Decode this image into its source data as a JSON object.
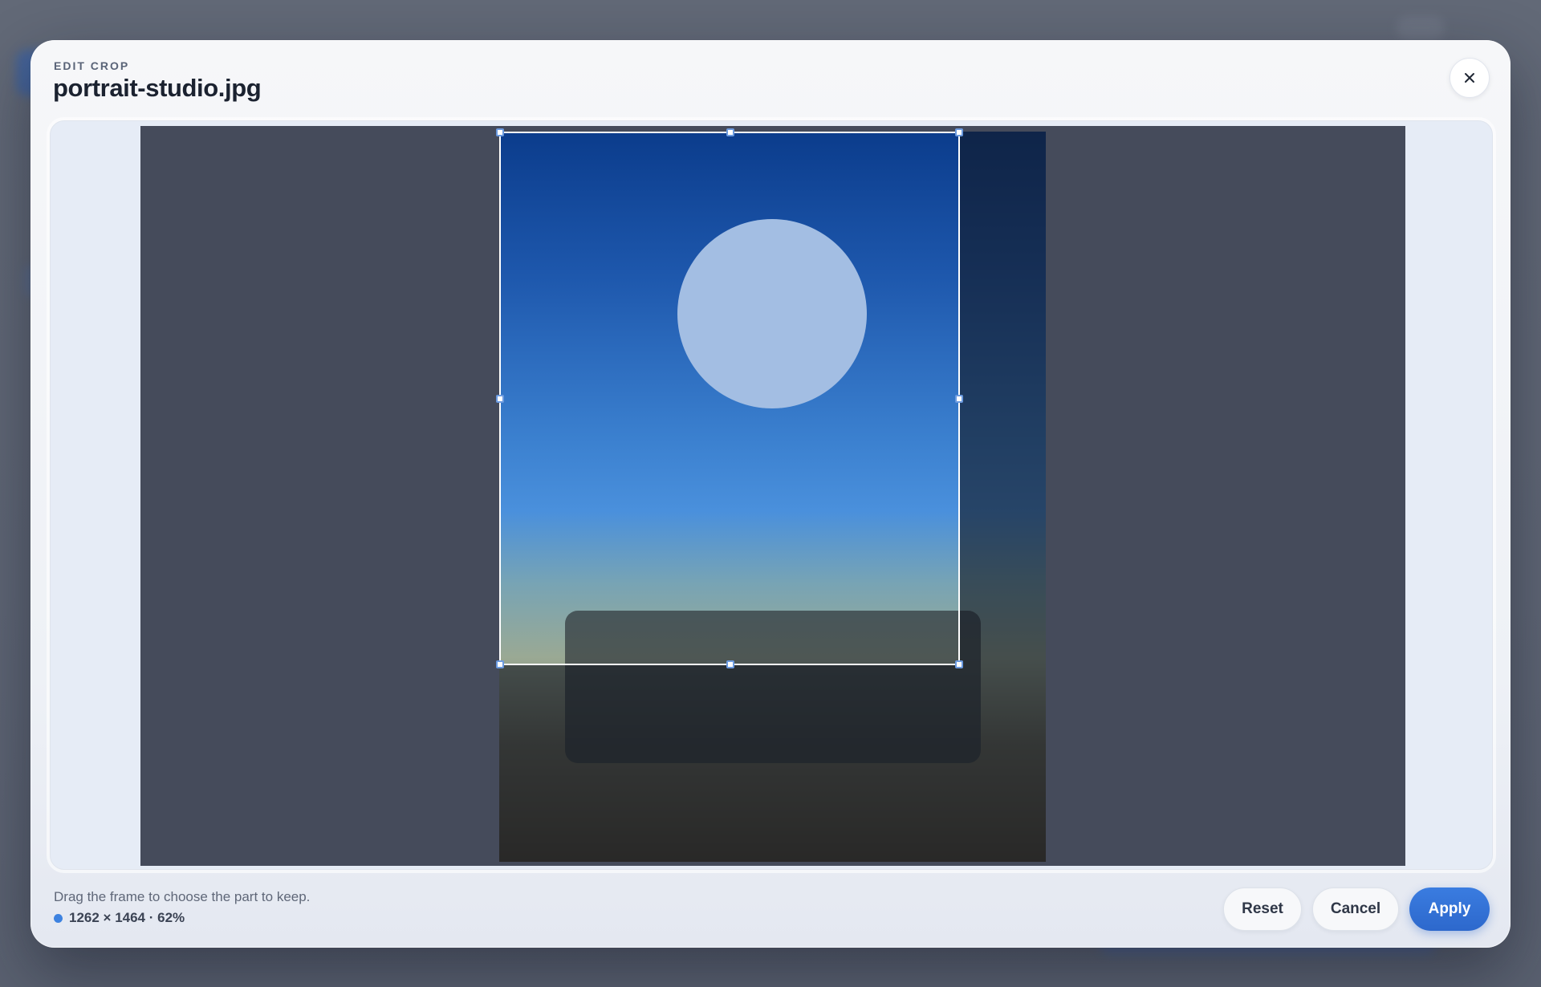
{
  "dialog": {
    "eyebrow": "EDIT CROP",
    "title": "portrait-studio.jpg",
    "close_icon": "close-icon"
  },
  "footer": {
    "hint": "Drag the frame to choose the part to keep.",
    "dimensions": "1262 × 1464 · 62%",
    "status_color": "#3d82e0"
  },
  "actions": {
    "reset_label": "Reset",
    "cancel_label": "Cancel",
    "apply_label": "Apply"
  },
  "colors": {
    "accent": "#2d68cc",
    "stage": "#454b5b"
  }
}
